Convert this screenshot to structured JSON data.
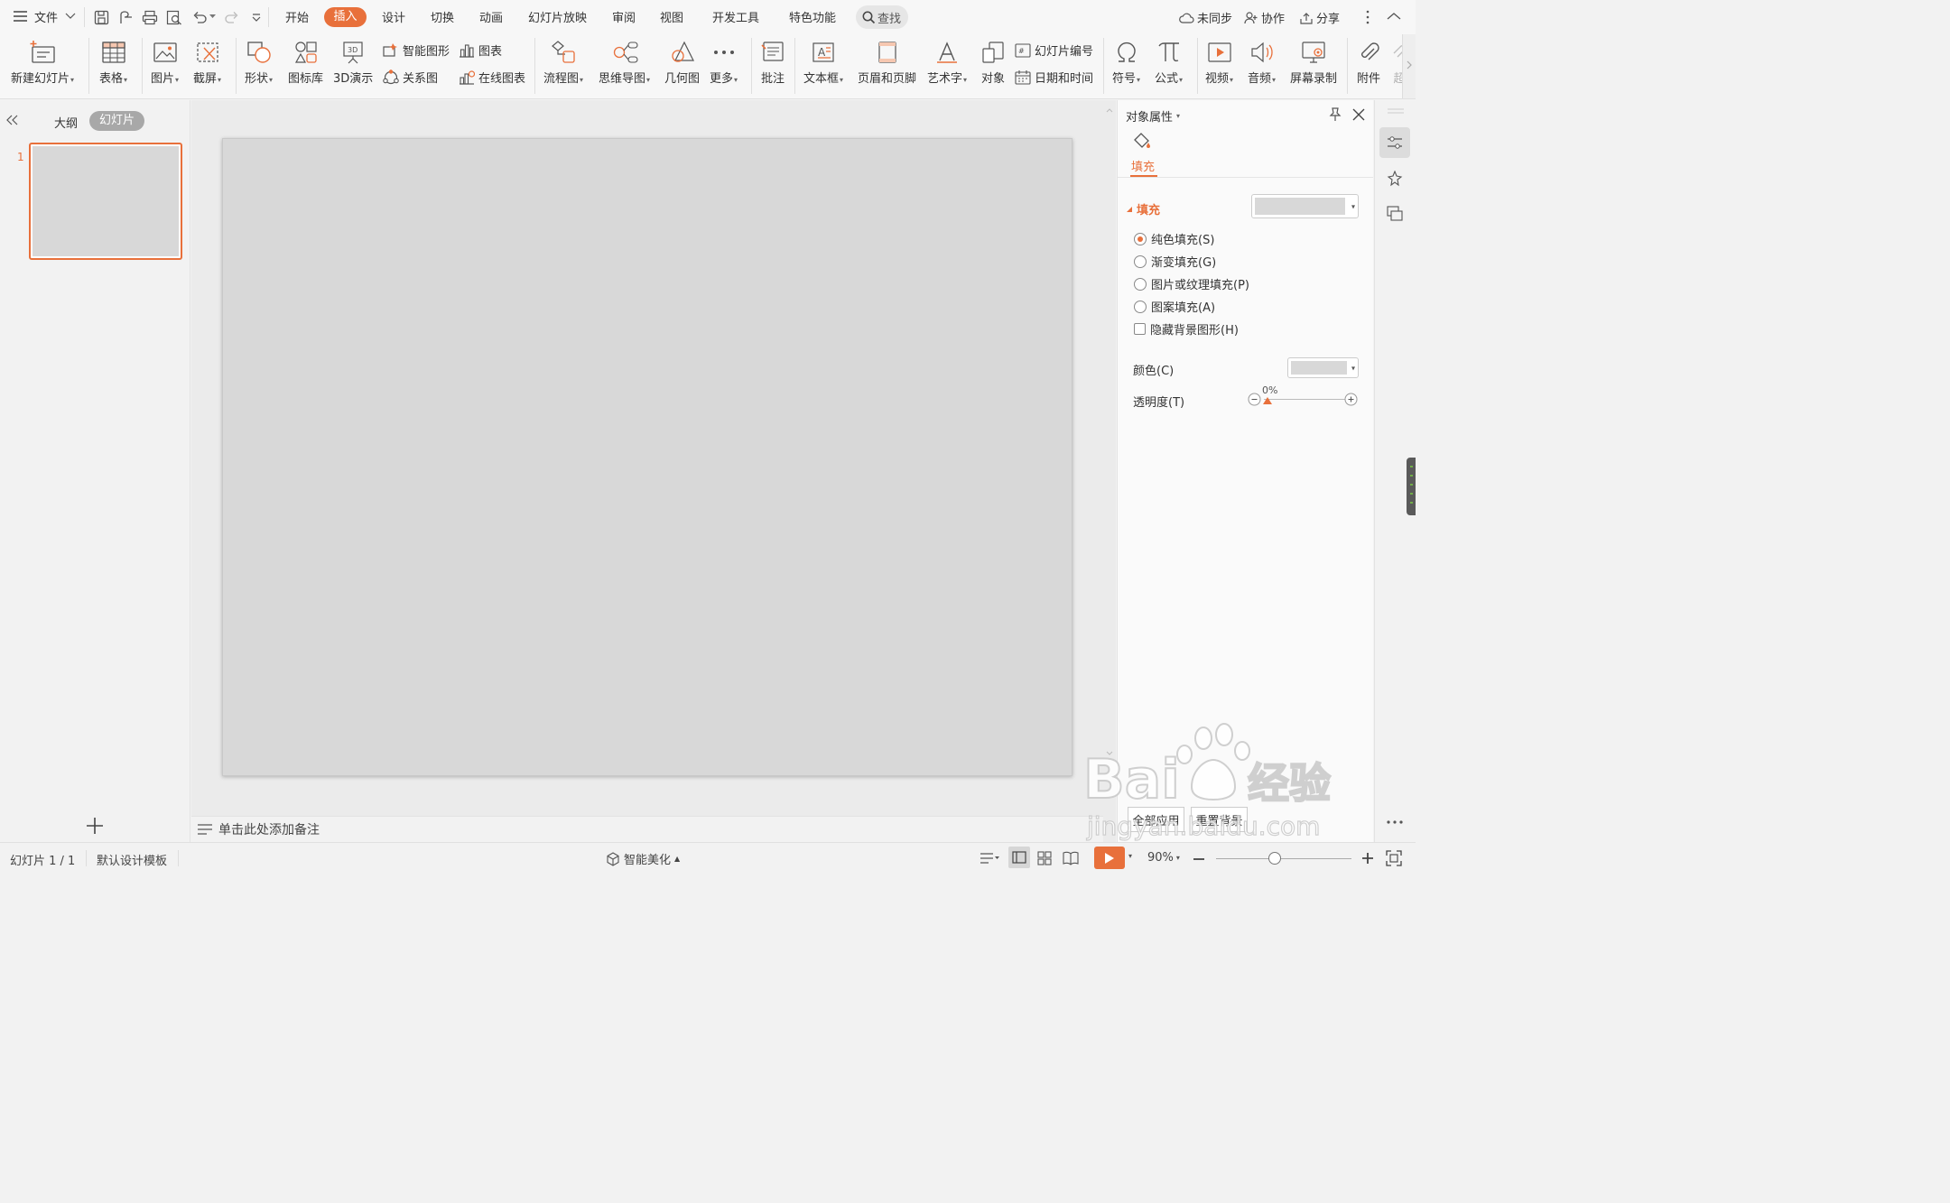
{
  "menu": {
    "file": "文件",
    "tabs": [
      "开始",
      "插入",
      "设计",
      "切换",
      "动画",
      "幻灯片放映",
      "审阅",
      "视图",
      "开发工具",
      "特色功能"
    ],
    "search": "查找",
    "right": {
      "sync": "未同步",
      "collab": "协作",
      "share": "分享"
    }
  },
  "ribbon": {
    "new_slide": "新建幻灯片",
    "table": "表格",
    "picture": "图片",
    "screenshot": "截屏",
    "shape": "形状",
    "icon_lib": "图标库",
    "demo3d": "3D演示",
    "smart_shape": "智能图形",
    "chart": "图表",
    "relation": "关系图",
    "online_chart": "在线图表",
    "flowchart": "流程图",
    "mindmap": "思维导图",
    "geometry": "几何图",
    "more": "更多",
    "comment": "批注",
    "textbox": "文本框",
    "header_footer": "页眉和页脚",
    "wordart": "艺术字",
    "object": "对象",
    "slide_number": "幻灯片编号",
    "datetime": "日期和时间",
    "symbol": "符号",
    "formula": "公式",
    "video": "视频",
    "audio": "音频",
    "screen_record": "屏幕录制",
    "attachment": "附件",
    "hyperlink_partial": "超"
  },
  "left_panel": {
    "outline_tab": "大纲",
    "slides_tab": "幻灯片",
    "slide_index": "1"
  },
  "notes": {
    "placeholder": "单击此处添加备注"
  },
  "props": {
    "title": "对象属性",
    "tab_fill": "填充",
    "section_fill": "填充",
    "options": [
      "纯色填充(S)",
      "渐变填充(G)",
      "图片或纹理填充(P)",
      "图案填充(A)"
    ],
    "hide_bg": "隐藏背景图形(H)",
    "color_label": "颜色(C)",
    "transparency_label": "透明度(T)",
    "transparency_value": "0%",
    "apply_all": "全部应用",
    "reset_bg": "重置背景"
  },
  "status": {
    "slide_count": "幻灯片 1 / 1",
    "template": "默认设计模板",
    "beautify": "智能美化",
    "zoom": "90%"
  },
  "watermark": {
    "brand": "Baidu经验",
    "url": "jingyan.baidu.com"
  },
  "colors": {
    "accent": "#e8703b",
    "slide_fill": "#d8d8d8"
  }
}
